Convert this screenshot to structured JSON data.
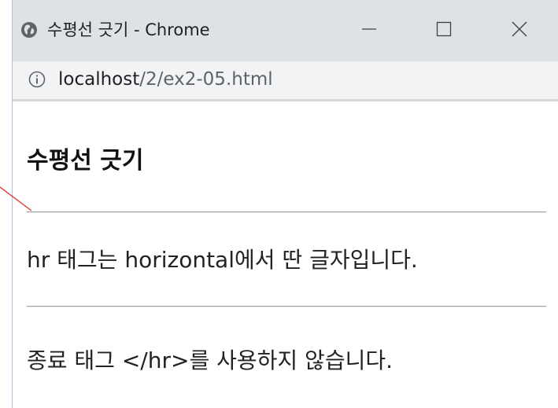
{
  "window": {
    "title": "수평선 긋기 - Chrome",
    "icon": "globe-icon",
    "controls": {
      "minimize_icon": "minimize-icon",
      "maximize_icon": "maximize-icon",
      "close_icon": "close-icon"
    }
  },
  "address_bar": {
    "info_icon": "info-icon",
    "host": "localhost",
    "path": "/2/ex2-05.html"
  },
  "content": {
    "heading": "수평선 긋기",
    "paragraph_1": "hr 태그는 horizontal에서 딴 글자입니다.",
    "paragraph_2": "종료 태그 </hr>를 사용하지 않습니다."
  },
  "colors": {
    "titlebar_bg": "#dee1e6",
    "addressbar_bg": "#f1f3f4",
    "annotation_line": "#d9342b"
  }
}
